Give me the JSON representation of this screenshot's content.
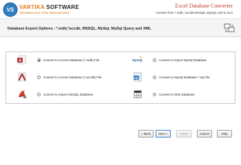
{
  "header": {
    "brand_main": "VARTIKA",
    "brand_rest": " SOFTWARE",
    "tagline": "TECHNOLOGY FOR INNOVATORS",
    "app_title": "Excel Database Converter",
    "app_subtitle": "Convert from *.mdb,*.accdb,MSSQL,MySQL,xml to XLS"
  },
  "section": {
    "title": "Database Export Options :  *.mdb,*accdb, MSSQL, MySql, MySql Query and XML"
  },
  "options": [
    {
      "label": "Convert to Access Database (*.mdb) File",
      "selected": true,
      "icon": "access-mdb-icon"
    },
    {
      "label": "Convert to Import MySql Database",
      "selected": false,
      "icon": "mysql-icon"
    },
    {
      "label": "Convert to Access Database (*.accdb) File",
      "selected": false,
      "icon": "access-accdb-icon"
    },
    {
      "label": "Convert to MySql Database *.sql File",
      "selected": false,
      "icon": "sql-file-icon"
    },
    {
      "label": "Convert to Import MSSQL Database",
      "selected": false,
      "icon": "mssql-icon"
    },
    {
      "label": "Convert to XML Database",
      "selected": false,
      "icon": "xml-grid-icon"
    }
  ],
  "footer": {
    "back": "< Back",
    "next": "Next >",
    "finish": "Finish",
    "cancel": "Cancel",
    "help": "Help"
  },
  "colors": {
    "accent_orange": "#e07a16",
    "title_red": "#c0392b"
  }
}
